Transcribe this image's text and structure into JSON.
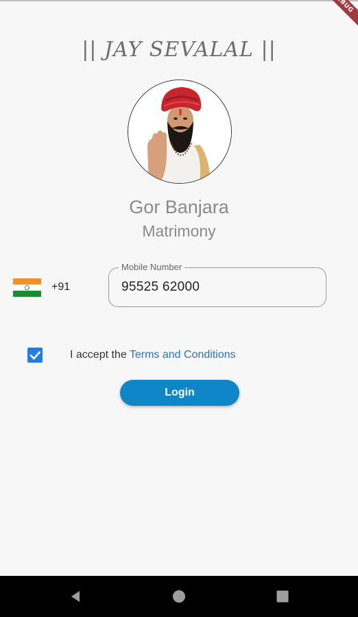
{
  "tagline": "|| JAY SEVALAL ||",
  "debug_banner": "DEBUG",
  "app_name": "Gor Banjara",
  "app_subtitle": "Matrimony",
  "phone": {
    "country_code": "+91",
    "flag": "india-flag",
    "field_label": "Mobile Number",
    "value": "95525 62000"
  },
  "terms": {
    "checked": true,
    "prefix": "I accept the ",
    "link": "Terms and Conditions"
  },
  "login_label": "Login",
  "colors": {
    "accent": "#0e86c8",
    "link": "#2a72c8",
    "checkbox": "#1e7fe0"
  },
  "navigation": [
    "back-icon",
    "home-icon",
    "recents-icon"
  ]
}
